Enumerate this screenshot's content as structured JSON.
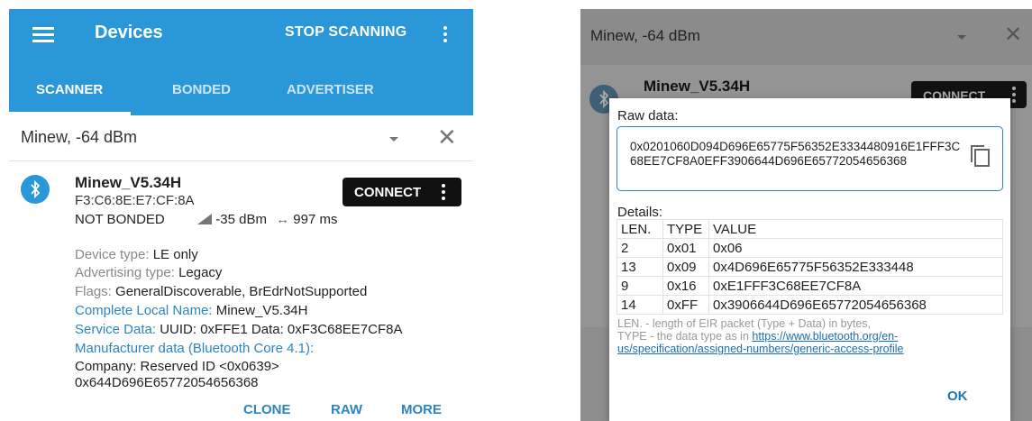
{
  "left": {
    "app_title": "Devices",
    "stop_scanning": "STOP SCANNING",
    "tabs": [
      {
        "label": "SCANNER"
      },
      {
        "label": "BONDED"
      },
      {
        "label": "ADVERTISER"
      }
    ],
    "filter_text": "Minew, -64 dBm",
    "device": {
      "name": "Minew_V5.34H",
      "mac": "F3:C6:8E:E7:CF:8A",
      "bond_state": "NOT BONDED",
      "rssi": "-35 dBm",
      "interval": "997 ms",
      "connect_label": "CONNECT",
      "device_type_key": "Device type:",
      "device_type_val": "LE only",
      "adv_type_key": "Advertising type:",
      "adv_type_val": "Legacy",
      "flags_key": "Flags:",
      "flags_val": "GeneralDiscoverable, BrEdrNotSupported",
      "local_name_key": "Complete Local Name:",
      "local_name_val": "Minew_V5.34H",
      "service_data_key": "Service Data:",
      "service_data_val": "UUID: 0xFFE1 Data: 0xF3C68EE7CF8A",
      "mfr_key": "Manufacturer data (Bluetooth Core 4.1):",
      "mfr_line1": "Company: Reserved ID <0x0639>",
      "mfr_line2": "0x644D696E65772054656368"
    },
    "actions": {
      "clone": "CLONE",
      "raw": "RAW",
      "more": "MORE"
    }
  },
  "right": {
    "filter_text": "Minew, -64 dBm",
    "bg_device_name": "Minew_V5.34H",
    "bg_connect_label": "CONNECT",
    "dialog": {
      "raw_label": "Raw data:",
      "raw_value": "0x0201060D094D696E65775F56352E3334480916E1FFF3C68EE7CF8A0EFF3906644D696E65772054656368",
      "details_label": "Details:",
      "columns": [
        "LEN.",
        "TYPE",
        "VALUE"
      ],
      "rows": [
        {
          "len": "2",
          "type": "0x01",
          "value": "0x06"
        },
        {
          "len": "13",
          "type": "0x09",
          "value": "0x4D696E65775F56352E333448"
        },
        {
          "len": "9",
          "type": "0x16",
          "value": "0xE1FFF3C68EE7CF8A"
        },
        {
          "len": "14",
          "type": "0xFF",
          "value": "0x3906644D696E65772054656368"
        }
      ],
      "note_line1": "LEN. - length of EIR packet (Type + Data) in bytes,",
      "note_line2_prefix": "TYPE - the data type as in ",
      "note_link": "https://www.bluetooth.org/en-us/specification/assigned-numbers/generic-access-profile",
      "ok_label": "OK"
    }
  },
  "icons": {
    "menu": "menu-icon",
    "more": "more-vert-icon",
    "close": "close-icon",
    "bluetooth": "bluetooth-icon",
    "signal": "signal-icon",
    "interval": "interval-arrows-icon",
    "copy": "copy-icon"
  },
  "colors": {
    "primary": "#2a97d9",
    "accent": "#2a85c2",
    "connect_bg": "#111111"
  }
}
